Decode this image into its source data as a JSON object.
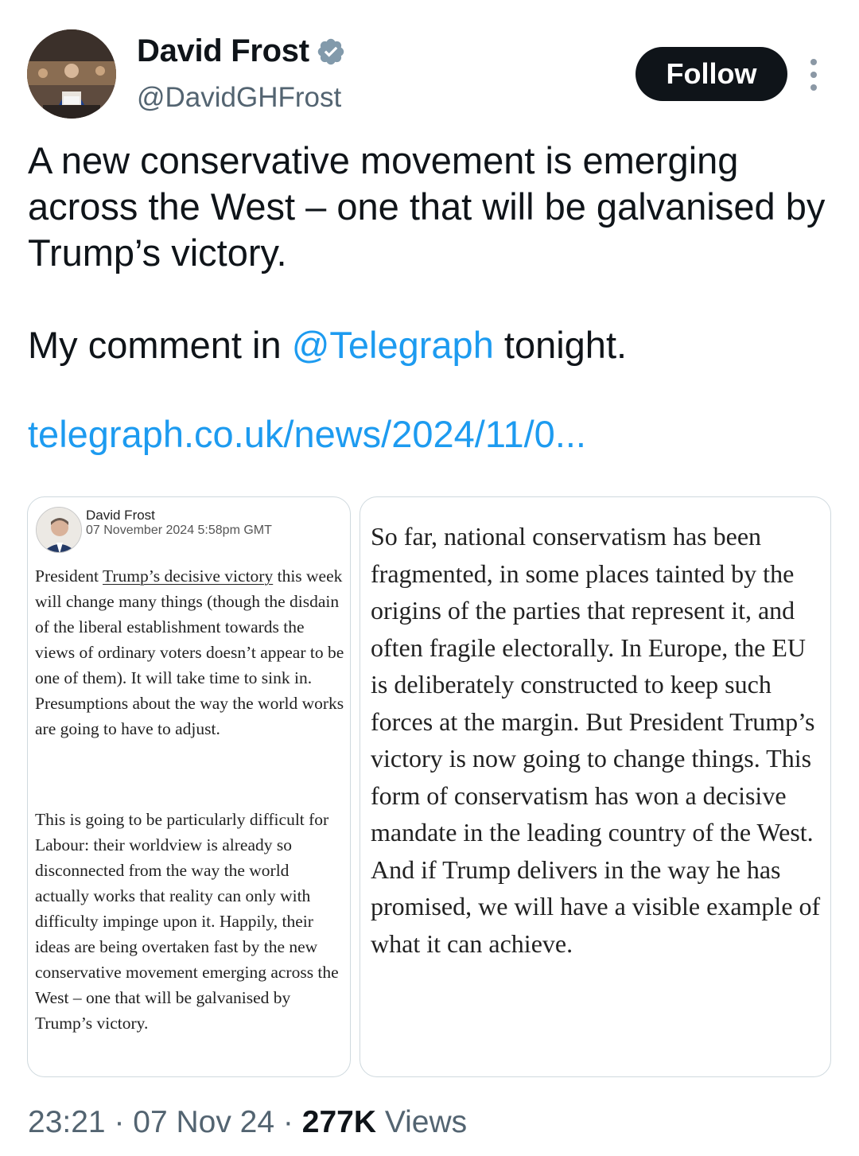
{
  "author": {
    "name": "David Frost",
    "handle": "@DavidGHFrost",
    "verified": true,
    "verified_icon": "verified-badge-icon"
  },
  "actions": {
    "follow_label": "Follow",
    "more_icon": "more-vertical-icon"
  },
  "tweet": {
    "line1": "A new conservative movement is emerging across the West – one that will be galvanised by Trump’s victory.",
    "line2_before": "My comment in ",
    "mention": "@Telegraph",
    "line2_after": " tonight.",
    "link": "telegraph.co.uk/news/2024/11/0..."
  },
  "media": {
    "left": {
      "byline_name": "David Frost",
      "byline_date": "07 November 2024 5:58pm GMT",
      "para1_before": "President ",
      "para1_link": "Trump’s decisive victory",
      "para1_after": " this week will change many things (though the disdain of the liberal establishment towards the views of ordinary voters doesn’t appear to be one of them). It will take time to sink in. Presumptions about the way the world works are going to have to adjust.",
      "para2": "This is going to be particularly difficult for Labour: their worldview is already so disconnected from the way the world actually works that reality can only with difficulty impinge upon it. Happily, their ideas are being overtaken fast by the new conservative movement emerging across the West – one that will be galvanised by Trump’s victory."
    },
    "right": {
      "para": "So far, national conservatism has been fragmented, in some places tainted by the origins of the parties that represent it, and often fragile electorally. In Europe, the EU is deliberately constructed to keep such forces at the margin. But President Trump’s victory is now going to change things. This form of conservatism has won a decisive mandate in the leading country of the West. And if Trump delivers in the way he has promised, we will have a visible example of what it can achieve."
    }
  },
  "meta": {
    "time": "23:21",
    "separator": " · ",
    "date": "07 Nov 24",
    "views_count": "277K",
    "views_label": " Views"
  },
  "colors": {
    "link": "#1d9bf0",
    "text": "#0f1419",
    "secondary": "#536471",
    "border": "#cfd9de",
    "verified": "#829aab"
  }
}
